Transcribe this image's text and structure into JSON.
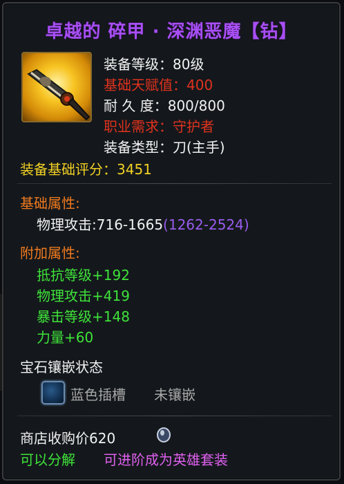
{
  "item": {
    "title": "卓越的 碎甲 · 深渊恶魔【钻】",
    "icon": "sword-icon",
    "stats": {
      "level_label": "装备等级：",
      "level_value": "80级",
      "talent_label": "基础天赋值：",
      "talent_value": "400",
      "durability_label": "耐 久 度：",
      "durability_value": "800/800",
      "class_label": "职业需求：",
      "class_value": "守护者",
      "type_label": "装备类型：",
      "type_value": "刀(主手)"
    },
    "score_label": "装备基础评分：",
    "score_value": "3451"
  },
  "base_attributes": {
    "header": "基础属性:",
    "items": [
      {
        "label": "物理攻击:",
        "value": "716-1665",
        "extra": "(1262-2524)"
      }
    ]
  },
  "additional_attributes": {
    "header": "附加属性:",
    "items": [
      "抵抗等级+192",
      "物理攻击+419",
      "暴击等级+148",
      "力量+60"
    ]
  },
  "gems": {
    "header": "宝石镶嵌状态",
    "slot_label": "蓝色插槽",
    "slot_status": "未镶嵌"
  },
  "footer": {
    "shop_price_label": "商店收购价620",
    "coin_icon": "coin-icon",
    "decomposable": "可以分解",
    "upgrade": "可进阶成为英雄套装"
  },
  "colors": {
    "title": "#a74ff5",
    "red": "#e0321e",
    "yellow": "#f2d024",
    "orange": "#f07a1e",
    "green": "#3fe33a",
    "purple": "#9a5cf0",
    "magenta": "#e060f0"
  }
}
